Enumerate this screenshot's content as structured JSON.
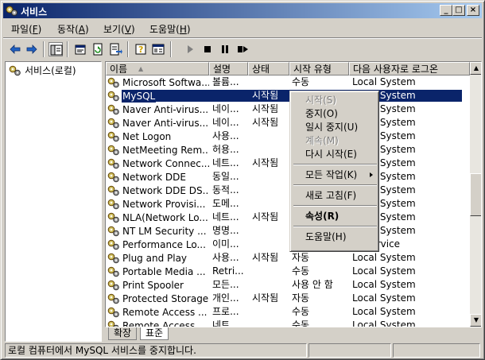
{
  "window": {
    "title": "서비스",
    "controls": {
      "minimize": "_",
      "maximize": "□",
      "close": "×"
    }
  },
  "menu": [
    {
      "label": "파일(",
      "key": "F",
      "end": ")"
    },
    {
      "label": "동작(",
      "key": "A",
      "end": ")"
    },
    {
      "label": "보기(",
      "key": "V",
      "end": ")"
    },
    {
      "label": "도움말(",
      "key": "H",
      "end": ")"
    }
  ],
  "toolbar": {
    "icons": [
      "back-arrow-icon",
      "forward-arrow-icon",
      "show-hide-tree-icon",
      "properties-icon",
      "refresh-icon",
      "export-list-icon",
      "help-icon",
      "console-tree-icon",
      "start-service-icon",
      "stop-service-icon",
      "pause-service-icon",
      "restart-service-icon"
    ]
  },
  "tree": {
    "root_label": "서비스(로컬)"
  },
  "list": {
    "columns": [
      "이름",
      "설명",
      "상태",
      "시작 유형",
      "다음 사용자로 로그온"
    ],
    "sort_arrow": "▲",
    "rows": [
      {
        "name": "Microsoft Softwa...",
        "desc": "볼륨...",
        "status": "",
        "type": "수동",
        "logon": "Local System"
      },
      {
        "name": "MySQL",
        "desc": "",
        "status": "시작됨",
        "type": "",
        "logon": "Local System",
        "selected": true
      },
      {
        "name": "Naver Anti-virus...",
        "desc": "네이...",
        "status": "시작됨",
        "type": "",
        "logon": "Local System"
      },
      {
        "name": "Naver Anti-virus...",
        "desc": "네이...",
        "status": "시작됨",
        "type": "",
        "logon": "Local System"
      },
      {
        "name": "Net Logon",
        "desc": "사용...",
        "status": "",
        "type": "",
        "logon": "Local System"
      },
      {
        "name": "NetMeeting Rem...",
        "desc": "허용...",
        "status": "",
        "type": "",
        "logon": "Local System"
      },
      {
        "name": "Network Connec...",
        "desc": "네트...",
        "status": "시작됨",
        "type": "",
        "logon": "Local System"
      },
      {
        "name": "Network DDE",
        "desc": "동일...",
        "status": "",
        "type": "",
        "logon": "Local System"
      },
      {
        "name": "Network DDE DS...",
        "desc": "동적...",
        "status": "",
        "type": "",
        "logon": "Local System"
      },
      {
        "name": "Network Provisi...",
        "desc": "도메...",
        "status": "",
        "type": "",
        "logon": "Local System"
      },
      {
        "name": "NLA(Network Lo...",
        "desc": "네트...",
        "status": "시작됨",
        "type": "",
        "logon": "Local System"
      },
      {
        "name": "NT LM Security ...",
        "desc": "명명...",
        "status": "",
        "type": "",
        "logon": "Local System"
      },
      {
        "name": "Performance Lo...",
        "desc": "이미...",
        "status": "",
        "type": "",
        "logon": "rk Service"
      },
      {
        "name": "Plug and Play",
        "desc": "사용...",
        "status": "시작됨",
        "type": "자동",
        "logon": "Local System"
      },
      {
        "name": "Portable Media ...",
        "desc": "Retri...",
        "status": "",
        "type": "수동",
        "logon": "Local System"
      },
      {
        "name": "Print Spooler",
        "desc": "모든...",
        "status": "",
        "type": "사용 안 함",
        "logon": "Local System"
      },
      {
        "name": "Protected Storage",
        "desc": "개인...",
        "status": "시작됨",
        "type": "자동",
        "logon": "Local System"
      },
      {
        "name": "Remote Access ...",
        "desc": "프로...",
        "status": "",
        "type": "수동",
        "logon": "Local System"
      },
      {
        "name": "Remote Access ...",
        "desc": "네트...",
        "status": "",
        "type": "수동",
        "logon": "Local System"
      }
    ]
  },
  "tabs": [
    "확장",
    "표준"
  ],
  "status": {
    "message": "로컬 컴퓨터에서 MySQL 서비스를 중지합니다."
  },
  "context_menu": [
    {
      "label": "시작(S)",
      "disabled": true
    },
    {
      "label": "중지(O)"
    },
    {
      "label": "일시 중지(U)"
    },
    {
      "label": "계속(M)",
      "disabled": true
    },
    {
      "label": "다시 시작(E)"
    },
    {
      "separator": true
    },
    {
      "label": "모든 작업(K)",
      "submenu": true
    },
    {
      "separator": true
    },
    {
      "label": "새로 고침(F)"
    },
    {
      "separator": true
    },
    {
      "label": "속성(R)",
      "bold": true
    },
    {
      "separator": true
    },
    {
      "label": "도움말(H)"
    }
  ]
}
